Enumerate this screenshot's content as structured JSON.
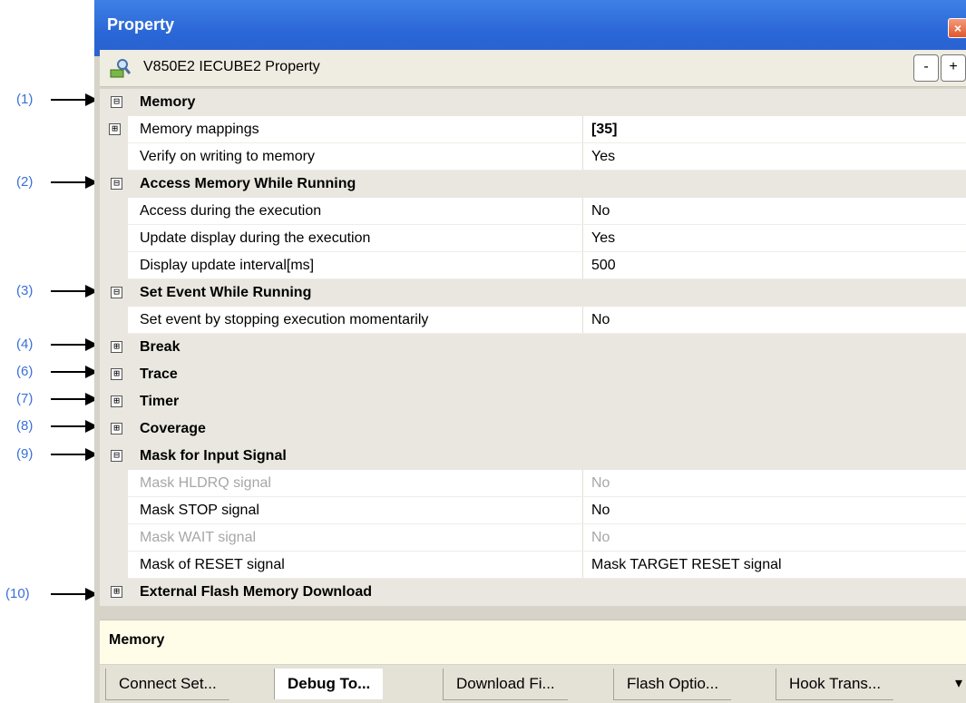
{
  "window": {
    "title": "Property",
    "close_label": "×"
  },
  "header": {
    "title": "V850E2 IECUBE2 Property",
    "collapse_label": "-",
    "expand_label": "+"
  },
  "callouts": [
    "(1)",
    "(2)",
    "(3)",
    "(4)",
    "(6)",
    "(7)",
    "(8)",
    "(9)",
    "(10)"
  ],
  "rows": [
    {
      "type": "cat",
      "expander": "⊟",
      "label": "Memory"
    },
    {
      "type": "prop",
      "expander": "⊞",
      "name": "Memory mappings",
      "value": "[35]",
      "bold": true
    },
    {
      "type": "prop",
      "expander": "",
      "name": "Verify on writing to memory",
      "value": "Yes"
    },
    {
      "type": "cat",
      "expander": "⊟",
      "label": "Access Memory While Running"
    },
    {
      "type": "prop",
      "expander": "",
      "name": "Access during the execution",
      "value": "No"
    },
    {
      "type": "prop",
      "expander": "",
      "name": "Update display during the execution",
      "value": "Yes"
    },
    {
      "type": "prop",
      "expander": "",
      "name": "Display update interval[ms]",
      "value": "500"
    },
    {
      "type": "cat",
      "expander": "⊟",
      "label": "Set Event While Running"
    },
    {
      "type": "prop",
      "expander": "",
      "name": "Set event by stopping execution momentarily",
      "value": "No"
    },
    {
      "type": "cat",
      "expander": "⊞",
      "label": "Break"
    },
    {
      "type": "cat",
      "expander": "⊞",
      "label": "Trace"
    },
    {
      "type": "cat",
      "expander": "⊞",
      "label": "Timer"
    },
    {
      "type": "cat",
      "expander": "⊞",
      "label": "Coverage"
    },
    {
      "type": "cat",
      "expander": "⊟",
      "label": "Mask for Input Signal"
    },
    {
      "type": "prop",
      "expander": "",
      "name": "Mask HLDRQ signal",
      "value": "No",
      "disabled": true
    },
    {
      "type": "prop",
      "expander": "",
      "name": "Mask STOP signal",
      "value": "No"
    },
    {
      "type": "prop",
      "expander": "",
      "name": "Mask WAIT signal",
      "value": "No",
      "disabled": true
    },
    {
      "type": "prop",
      "expander": "",
      "name": "Mask of RESET signal",
      "value": "Mask TARGET RESET signal"
    },
    {
      "type": "cat",
      "expander": "⊞",
      "label": "External Flash Memory Download"
    }
  ],
  "description": {
    "text": "Memory"
  },
  "tabs": [
    {
      "label": "Connect Set...",
      "active": false
    },
    {
      "label": "Debug To...",
      "active": true
    },
    {
      "label": "Download Fi...",
      "active": false
    },
    {
      "label": "Flash Optio...",
      "active": false
    },
    {
      "label": "Hook Trans...",
      "active": false
    }
  ],
  "tab_overflow_label": "▾",
  "colors": {
    "titlebar": "#2a66d6",
    "callout_text": "#3a6fd8",
    "disabled_text": "#a7a7a7",
    "description_bg": "#fffde8"
  }
}
